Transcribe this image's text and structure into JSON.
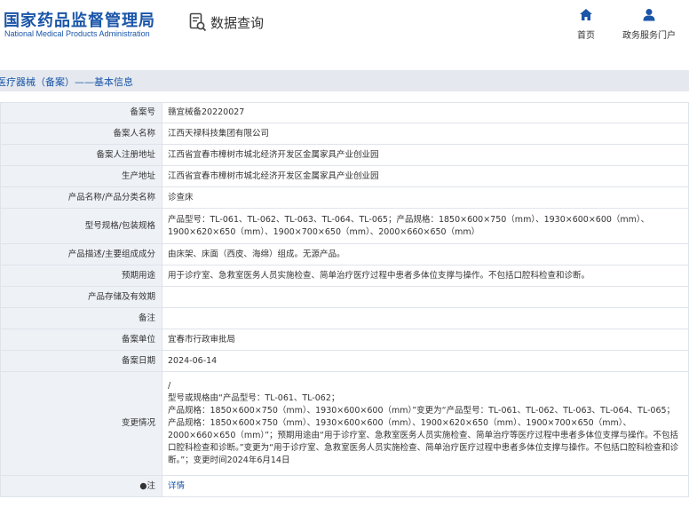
{
  "header": {
    "logo_cn": "国家药品监督管理局",
    "logo_en": "National Medical Products Administration",
    "page_name": "数据查询",
    "nav": [
      {
        "label": "首页",
        "icon": "home-icon"
      },
      {
        "label": "政务服务门户",
        "icon": "user-icon"
      }
    ]
  },
  "breadcrumb": "医疗器械（备案）——基本信息",
  "record": {
    "rows": [
      {
        "label": "备案号",
        "value": "赣宜械备20220027"
      },
      {
        "label": "备案人名称",
        "value": "江西天禄科技集团有限公司"
      },
      {
        "label": "备案人注册地址",
        "value": "江西省宜春市樟树市城北经济开发区金属家具产业创业园"
      },
      {
        "label": "生产地址",
        "value": "江西省宜春市樟树市城北经济开发区金属家具产业创业园"
      },
      {
        "label": "产品名称/产品分类名称",
        "value": "诊查床"
      },
      {
        "label": "型号规格/包装规格",
        "value": "产品型号：TL-061、TL-062、TL-063、TL-064、TL-065；产品规格：1850×600×750（mm）、1930×600×600（mm）、1900×620×650（mm）、1900×700×650（mm）、2000×660×650（mm）"
      },
      {
        "label": "产品描述/主要组成成分",
        "value": "由床架、床面（西皮、海绵）组成。无源产品。"
      },
      {
        "label": "预期用途",
        "value": "用于诊疗室、急救室医务人员实施检查、简单治疗医疗过程中患者多体位支撑与操作。不包括口腔科检查和诊断。"
      },
      {
        "label": "产品存储及有效期",
        "value": ""
      },
      {
        "label": "备注",
        "value": ""
      },
      {
        "label": "备案单位",
        "value": "宜春市行政审批局"
      },
      {
        "label": "备案日期",
        "value": "2024-06-14"
      },
      {
        "label": "变更情况",
        "value": "/\n型号或规格由“产品型号：TL-061、TL-062；\n产品规格：1850×600×750（mm）、1930×600×600（mm）”变更为“产品型号：TL-061、TL-062、TL-063、TL-064、TL-065；产品规格：1850×600×750（mm）、1930×600×600（mm）、1900×620×650（mm）、1900×700×650（mm）、2000×660×650（mm）”；预期用途由“用于诊疗室、急救室医务人员实施检查、简单治疗等医疗过程中患者多体位支撑与操作。不包括口腔科检查和诊断。”变更为“用于诊疗室、急救室医务人员实施检查、简单治疗医疗过程中患者多体位支撑与操作。不包括口腔科检查和诊断。”；变更时间2024年6月14日"
      }
    ],
    "note_label": "●注",
    "detail_link": "详情"
  }
}
